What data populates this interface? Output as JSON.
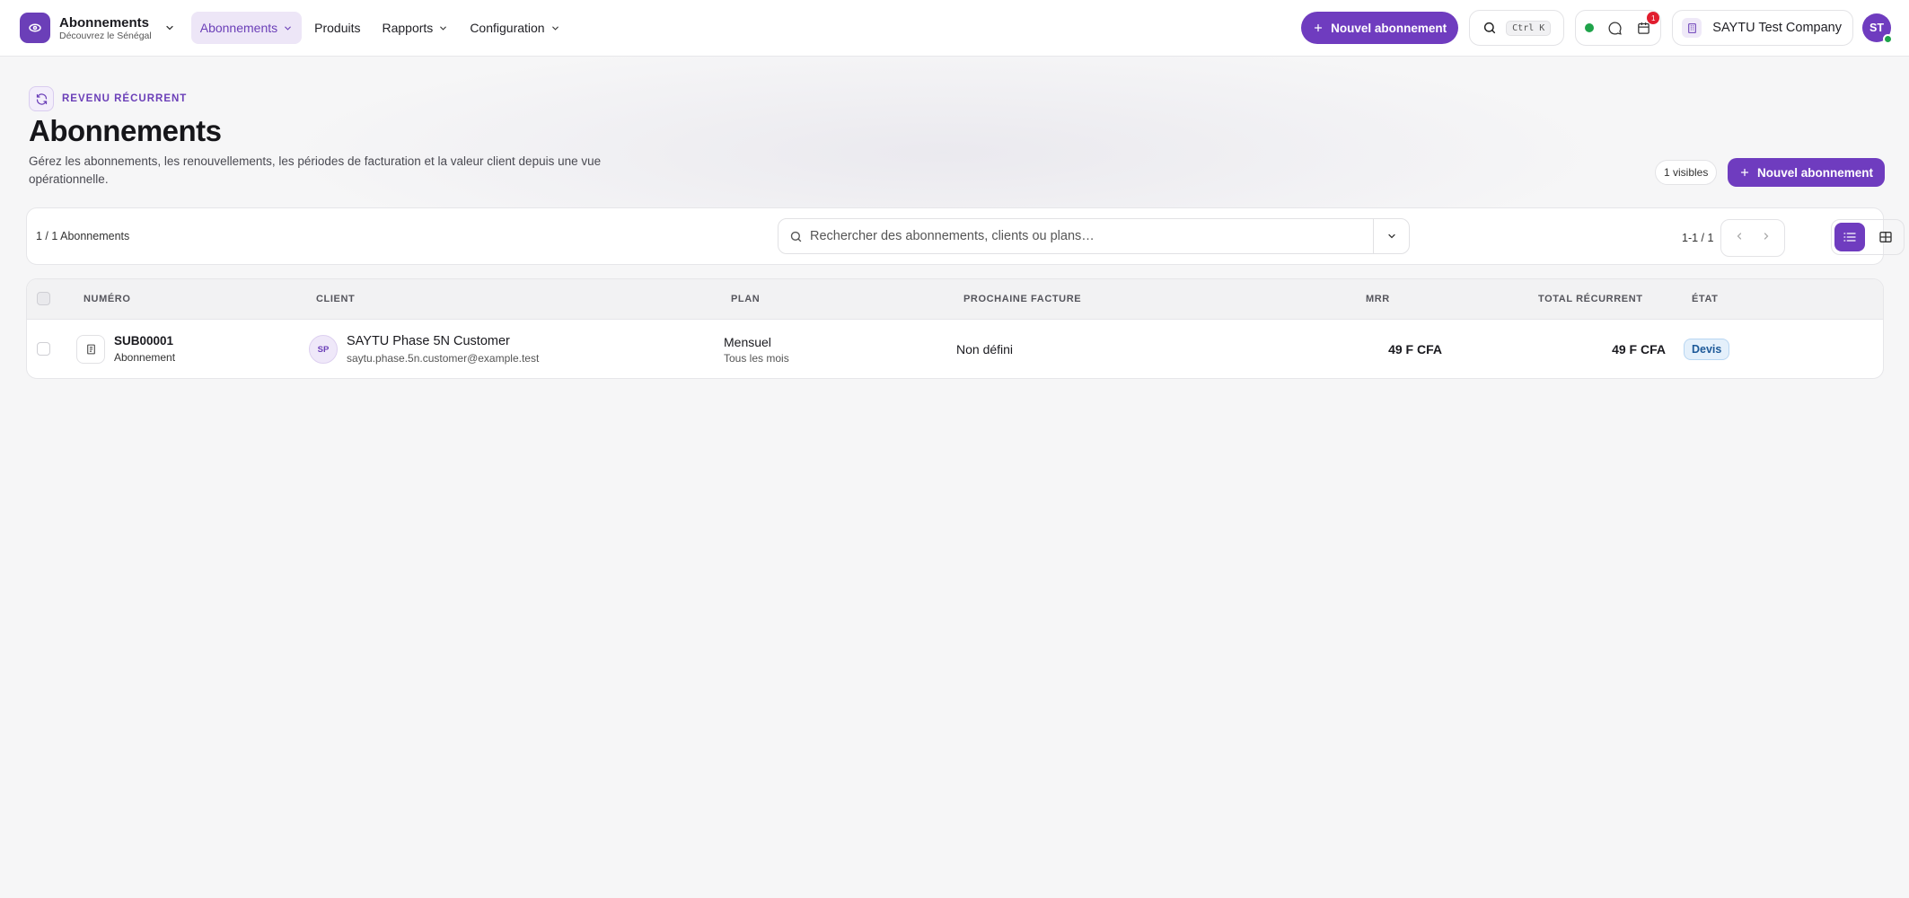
{
  "app": {
    "title": "Abonnements",
    "subtitle": "Découvrez le Sénégal"
  },
  "nav": {
    "items": [
      {
        "label": "Abonnements",
        "active": true,
        "has_dropdown": true
      },
      {
        "label": "Produits",
        "active": false,
        "has_dropdown": false
      },
      {
        "label": "Rapports",
        "active": false,
        "has_dropdown": true
      },
      {
        "label": "Configuration",
        "active": false,
        "has_dropdown": true
      }
    ]
  },
  "topbar": {
    "new_button_label": "Nouvel abonnement",
    "search_shortcut": "Ctrl K",
    "notification_count": "1",
    "company_name": "SAYTU Test Company",
    "user_initials": "ST"
  },
  "header": {
    "eyebrow": "REVENU RÉCURRENT",
    "title": "Abonnements",
    "description": "Gérez les abonnements, les renouvellements, les périodes de facturation et la valeur client depuis une vue opérationnelle.",
    "visible_count": "1 visibles",
    "new_button_label": "Nouvel abonnement"
  },
  "toolbar": {
    "count_text": "1 / 1 Abonnements",
    "search_placeholder": "Rechercher des abonnements, clients ou plans…",
    "pagination_text": "1-1 / 1",
    "active_view": "list"
  },
  "table": {
    "columns": [
      "NUMÉRO",
      "CLIENT",
      "PLAN",
      "PROCHAINE FACTURE",
      "MRR",
      "TOTAL RÉCURRENT",
      "ÉTAT"
    ],
    "rows": [
      {
        "number": "SUB00001",
        "type": "Abonnement",
        "client_initials": "SP",
        "client_name": "SAYTU Phase 5N Customer",
        "client_email": "saytu.phase.5n.customer@example.test",
        "plan": "Mensuel",
        "plan_frequency": "Tous les mois",
        "next_invoice": "Non défini",
        "mrr": "49 F CFA",
        "total_recurring": "49 F CFA",
        "status": "Devis"
      }
    ]
  },
  "colors": {
    "accent": "#6f3cbf",
    "accent_soft": "#ede6f7",
    "online": "#1fa34a",
    "alert": "#e11d2e",
    "status_info": "#1e5a99"
  }
}
